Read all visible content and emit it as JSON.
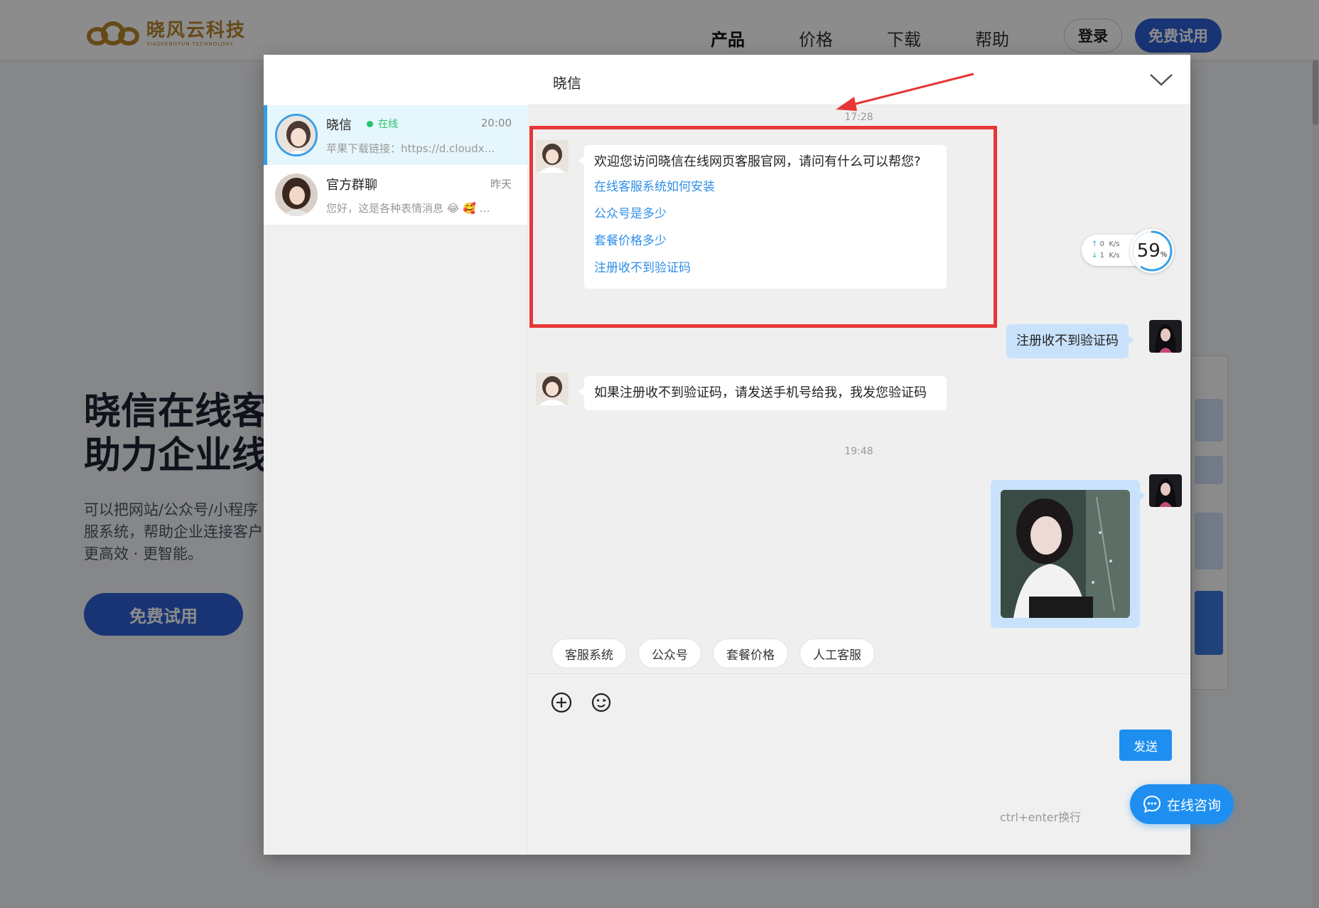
{
  "site": {
    "logo_text": "晓风云科技",
    "logo_sub": "XIAOFENGYUN TECHNOLOGY",
    "nav": [
      "产品",
      "价格",
      "下载",
      "帮助"
    ],
    "login": "登录",
    "trial": "免费试用",
    "hero_title_1": "晓信在线客",
    "hero_title_2": "助力企业线",
    "hero_desc_1": "可以把网站/公众号/小程序",
    "hero_desc_2": "服系统，帮助企业连接客户",
    "hero_desc_3": "更高效 · 更智能。",
    "hero_button": "免费试用"
  },
  "sidebar": {
    "conversations": [
      {
        "name": "晓信",
        "status": "在线",
        "time": "20:00",
        "preview": "苹果下载链接：https://d.cloudxiao.com/ios"
      },
      {
        "name": "官方群聊",
        "time": "昨天",
        "preview": "您好，这是各种表情消息 😂 🥰 …"
      }
    ]
  },
  "chat": {
    "title": "晓信",
    "timestamps": [
      "17:28",
      "19:48"
    ],
    "welcome": {
      "text": "欢迎您访问晓信在线网页客服官网，请问有什么可以帮您?",
      "links": [
        "在线客服系统如何安装",
        "公众号是多少",
        "套餐价格多少",
        "注册收不到验证码"
      ]
    },
    "user_message": "注册收不到验证码",
    "reply": "如果注册收不到验证码，请发送手机号给我，我发您验证码",
    "quick_replies": [
      "客服系统",
      "公众号",
      "套餐价格",
      "人工客服"
    ],
    "send": "发送",
    "hint": "ctrl+enter换行"
  },
  "speed": {
    "up": "0",
    "down": "1",
    "unit": "K/s",
    "percent_value": 59,
    "percent": "59",
    "percent_sign": "%"
  },
  "consult": {
    "label": "在线咨询"
  },
  "colors": {
    "accent": "#1e8ff0",
    "brand": "#2d5fd6",
    "highlight": "#e63636",
    "online": "#27c46b",
    "user_bubble": "#c9e2fb"
  }
}
